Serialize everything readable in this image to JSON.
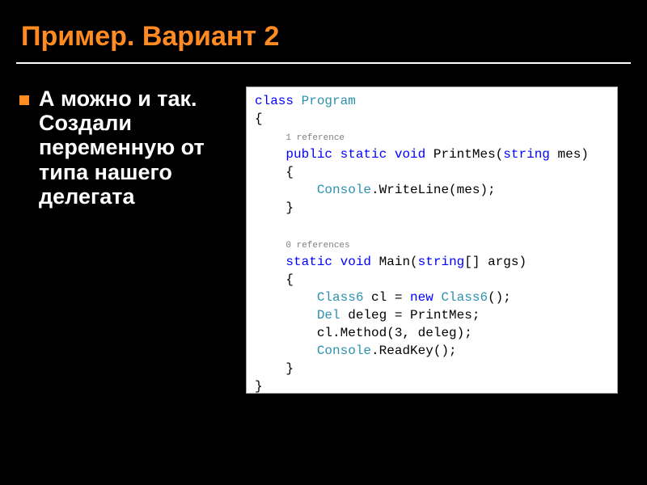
{
  "slide": {
    "title": "Пример. Вариант 2",
    "bullet": "А можно и так. Создали переменную от типа нашего делегата"
  },
  "code": {
    "l01_kw1": "class",
    "l01_cls1": "Program",
    "l02": "{",
    "l03_ref": "1 reference",
    "l04_kw1": "public",
    "l04_kw2": "static",
    "l04_kw3": "void",
    "l04_name": "PrintMes(",
    "l04_kw4": "string",
    "l04_rest": " mes)",
    "l05": "{",
    "l06_cls": "Console",
    "l06_rest": ".WriteLine(mes);",
    "l07": "}",
    "l08_ref": "0 references",
    "l09_kw1": "static",
    "l09_kw2": "void",
    "l09_name": "Main(",
    "l09_kw3": "string",
    "l09_rest": "[] args)",
    "l10": "{",
    "l11_cls1": "Class6",
    "l11_mid": " cl = ",
    "l11_kw1": "new",
    "l11_cls2": "Class6",
    "l11_end": "();",
    "l12_cls1": "Del",
    "l12_rest": " deleg = PrintMes;",
    "l13": "cl.Method(3, deleg);",
    "l14_cls": "Console",
    "l14_rest": ".ReadKey();",
    "l15": "}",
    "l16": "}"
  }
}
